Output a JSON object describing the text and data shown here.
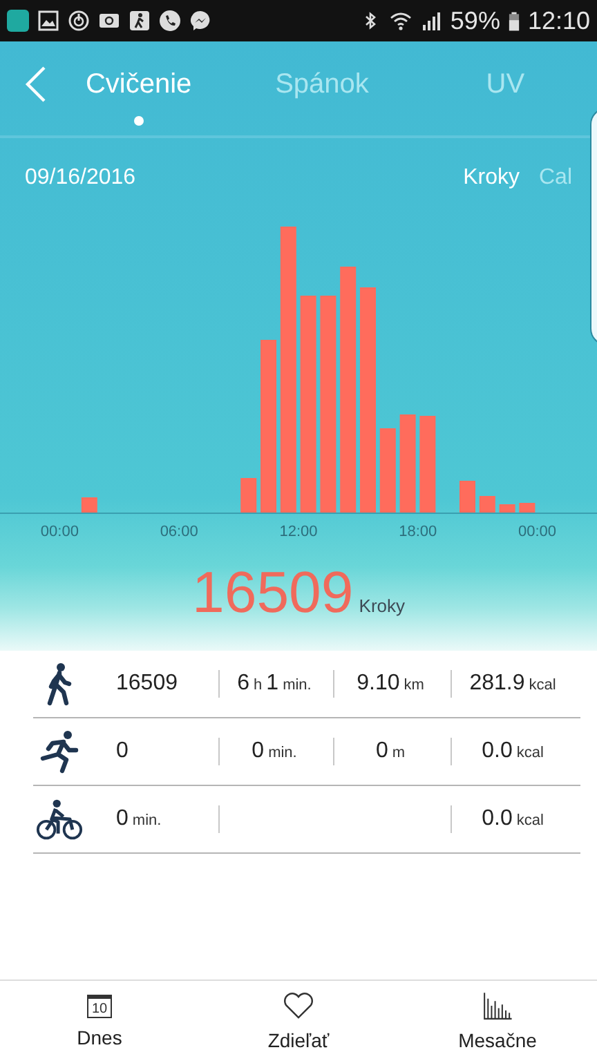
{
  "status_bar": {
    "battery": "59%",
    "time": "12:10"
  },
  "tabs": [
    {
      "label": "Cvičenie",
      "selected": true
    },
    {
      "label": "Spánok",
      "selected": false
    },
    {
      "label": "UV",
      "selected": false
    }
  ],
  "date": "09/16/2016",
  "units": [
    {
      "label": "Kroky",
      "selected": true
    },
    {
      "label": "Cal",
      "selected": false
    }
  ],
  "chart": {
    "axis_labels": [
      "00:00",
      "06:00",
      "12:00",
      "18:00",
      "00:00"
    ]
  },
  "total": {
    "value": "16509",
    "unit": "Kroky"
  },
  "activities": [
    {
      "kind": "walk",
      "cells": [
        {
          "parts": [
            {
              "v": "16509"
            }
          ]
        },
        {
          "parts": [
            {
              "v": "6",
              "u": "h"
            },
            {
              "v": "1",
              "u": "min."
            }
          ]
        },
        {
          "parts": [
            {
              "v": "9.10",
              "u": "km"
            }
          ]
        },
        {
          "parts": [
            {
              "v": "281.9",
              "u": "kcal"
            }
          ]
        }
      ]
    },
    {
      "kind": "run",
      "cells": [
        {
          "parts": [
            {
              "v": "0"
            }
          ]
        },
        {
          "parts": [
            {
              "v": "0",
              "u": "min."
            }
          ]
        },
        {
          "parts": [
            {
              "v": "0",
              "u": "m"
            }
          ]
        },
        {
          "parts": [
            {
              "v": "0.0",
              "u": "kcal"
            }
          ]
        }
      ]
    },
    {
      "kind": "bike",
      "cells": [
        {
          "parts": [
            {
              "v": "0",
              "u": "min."
            }
          ]
        },
        {
          "kind": "gap"
        },
        {
          "parts": [
            {
              "v": "0.0",
              "u": "kcal"
            }
          ]
        }
      ]
    }
  ],
  "nav": [
    {
      "kind": "calendar",
      "icon_text": "10",
      "label": "Dnes"
    },
    {
      "kind": "heart",
      "label": "Zdieľať"
    },
    {
      "kind": "bars",
      "label": "Mesačne"
    }
  ]
}
